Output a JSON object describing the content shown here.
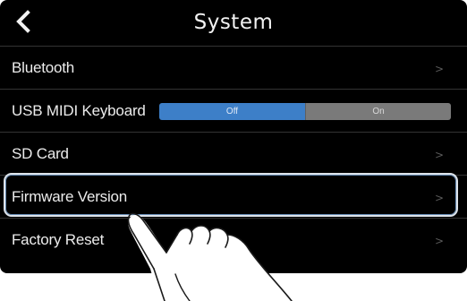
{
  "header": {
    "title": "System",
    "back_icon": "chevron-left-icon"
  },
  "menu": {
    "items": [
      {
        "label": "Bluetooth",
        "type": "link",
        "chevron": ">"
      },
      {
        "label": "USB MIDI Keyboard",
        "type": "toggle",
        "options": [
          "Off",
          "On"
        ],
        "selected": "Off"
      },
      {
        "label": "SD Card",
        "type": "link",
        "chevron": ">"
      },
      {
        "label": "Firmware Version",
        "type": "link",
        "chevron": ">",
        "highlighted": true
      },
      {
        "label": "Factory Reset",
        "type": "link",
        "chevron": ">"
      }
    ]
  },
  "colors": {
    "background": "#000000",
    "toggle_selected": "#3d7fc8",
    "toggle_unselected": "#7a7a7a",
    "highlight_outline": "#dde3ea"
  },
  "overlay": {
    "gesture": "tap",
    "target": "Firmware Version"
  }
}
